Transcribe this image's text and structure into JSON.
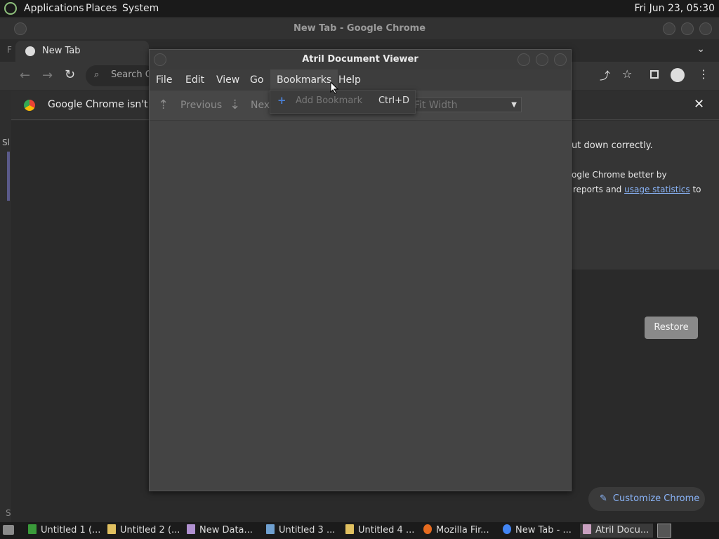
{
  "top_panel": {
    "menus": [
      "Applications",
      "Places",
      "System"
    ],
    "clock": "Fri Jun 23, 05:30"
  },
  "chrome": {
    "window_title": "New Tab - Google Chrome",
    "tab_title": "New Tab",
    "omnibox_placeholder": "Search G",
    "infobar_text": "Google Chrome isn't yo",
    "restore_line1": "ut down correctly.",
    "restore_line2": "ogle Chrome better by",
    "restore_line3_pre": "reports and ",
    "restore_link": "usage statistics",
    "restore_line3_post": " to",
    "restore_button": "Restore",
    "customize_button": "Customize Chrome",
    "left_edge_labels": [
      "F",
      "Sl",
      "S"
    ]
  },
  "atril": {
    "window_title": "Atril Document Viewer",
    "menus": [
      "File",
      "Edit",
      "View",
      "Go",
      "Bookmarks",
      "Help"
    ],
    "toolbar": {
      "previous": "Previous",
      "next": "Next",
      "zoom_value": "Fit Width"
    },
    "bookmarks_menu": {
      "item": "Add Bookmark",
      "shortcut": "Ctrl+D"
    }
  },
  "taskbar": {
    "items": [
      {
        "label": "Untitled 1 (...",
        "icon": "spreadsheet-icon",
        "color": "#3a9a3a"
      },
      {
        "label": "Untitled 2 (...",
        "icon": "document-icon",
        "color": "#e0c060"
      },
      {
        "label": "New Data...",
        "icon": "database-icon",
        "color": "#b090d0"
      },
      {
        "label": "Untitled 3 ...",
        "icon": "writer-icon",
        "color": "#6fa0d0"
      },
      {
        "label": "Untitled 4 ...",
        "icon": "document-icon",
        "color": "#e0c060"
      },
      {
        "label": "Mozilla Fir...",
        "icon": "firefox-icon",
        "color": "#e66b1f"
      },
      {
        "label": "New Tab - ...",
        "icon": "chrome-icon",
        "color": "#4285f4"
      },
      {
        "label": "Atril Docu...",
        "icon": "atril-icon",
        "color": "#c9a0c0"
      }
    ]
  }
}
